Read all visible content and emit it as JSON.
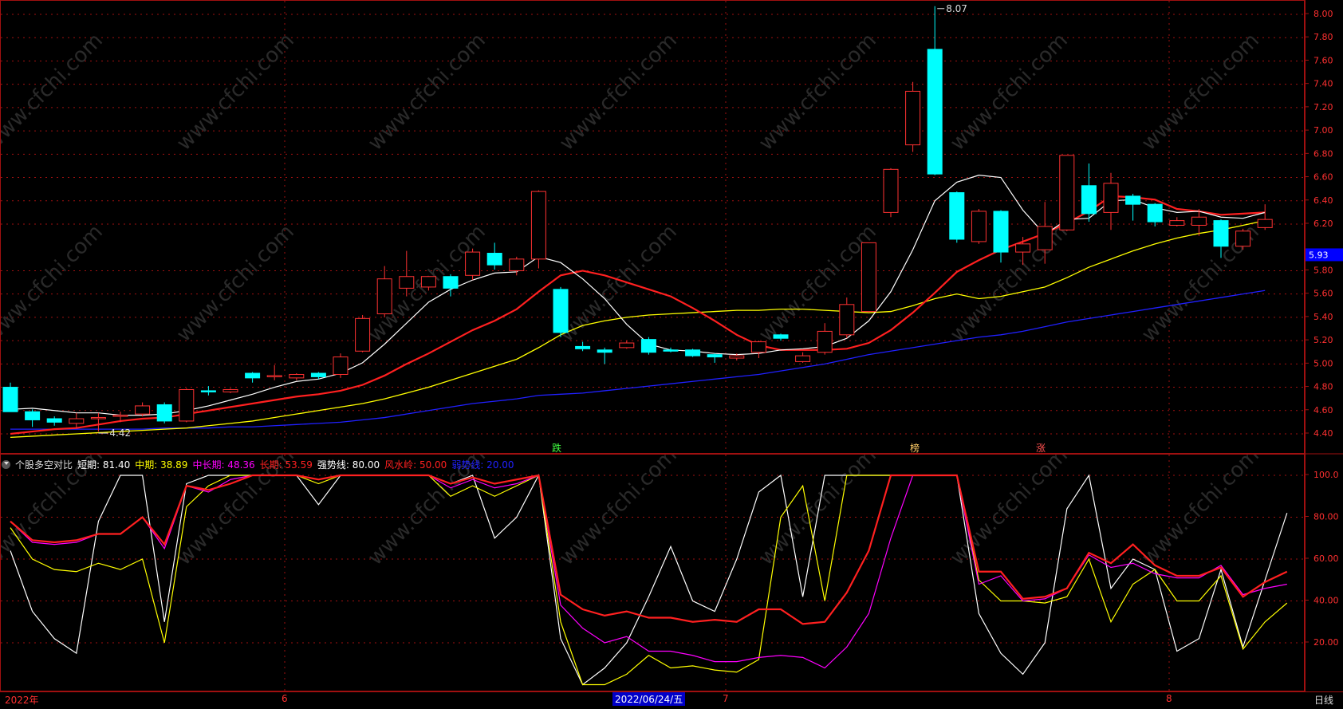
{
  "price_axis": {
    "labels": [
      "8.00",
      "7.80",
      "7.60",
      "7.40",
      "7.20",
      "7.00",
      "6.80",
      "6.60",
      "6.40",
      "6.20",
      "5.80",
      "5.60",
      "5.40",
      "5.20",
      "5.00",
      "4.80",
      "4.60",
      "4.40"
    ],
    "current_price": "5.93",
    "current_price_bg": "#0000ff"
  },
  "sub_axis": {
    "labels": [
      "100.0",
      "80.00",
      "60.00",
      "40.00",
      "20.00"
    ]
  },
  "annotations": {
    "high": "8.07",
    "low": "4.42",
    "marker_die": "跌",
    "marker_bang": "榜",
    "marker_zhang": "涨"
  },
  "indicator": {
    "name": "个股多空对比",
    "items": [
      {
        "text": "短期: 81.40",
        "color": "#ffffff"
      },
      {
        "text": "中期: 38.89",
        "color": "#ffff00"
      },
      {
        "text": "中长期: 48.36",
        "color": "#ff00ff"
      },
      {
        "text": "长期: 53.59",
        "color": "#ff2020"
      },
      {
        "text": "强势线: 80.00",
        "color": "#ffffff"
      },
      {
        "text": "风水岭: 50.00",
        "color": "#ff2020"
      },
      {
        "text": "弱势线: 20.00",
        "color": "#2020ff"
      }
    ]
  },
  "date_bar": {
    "year": "2022年",
    "m6": "6",
    "selected_date": "2022/06/24/五",
    "m7": "7",
    "m8": "8",
    "period": "日线"
  },
  "watermark": "www.cfchi.com",
  "colors": {
    "up": "#ff3232",
    "down": "#00ffff",
    "ma5": "#ffffff",
    "ma10": "#ff2020",
    "ma20": "#ffff00",
    "ma60": "#2020ff",
    "grid": "#a01010"
  },
  "candles": [
    {
      "o": 4.8,
      "h": 4.84,
      "l": 4.62,
      "c": 4.59
    },
    {
      "o": 4.59,
      "h": 4.61,
      "l": 4.46,
      "c": 4.52
    },
    {
      "o": 4.53,
      "h": 4.55,
      "l": 4.47,
      "c": 4.5
    },
    {
      "o": 4.49,
      "h": 4.58,
      "l": 4.45,
      "c": 4.53
    },
    {
      "o": 4.53,
      "h": 4.58,
      "l": 4.42,
      "c": 4.54
    },
    {
      "o": 4.55,
      "h": 4.59,
      "l": 4.5,
      "c": 4.56
    },
    {
      "o": 4.57,
      "h": 4.67,
      "l": 4.55,
      "c": 4.64
    },
    {
      "o": 4.65,
      "h": 4.67,
      "l": 4.49,
      "c": 4.51
    },
    {
      "o": 4.51,
      "h": 4.79,
      "l": 4.5,
      "c": 4.78
    },
    {
      "o": 4.77,
      "h": 4.81,
      "l": 4.73,
      "c": 4.76
    },
    {
      "o": 4.76,
      "h": 4.79,
      "l": 4.75,
      "c": 4.78
    },
    {
      "o": 4.92,
      "h": 4.93,
      "l": 4.84,
      "c": 4.88
    },
    {
      "o": 4.9,
      "h": 4.99,
      "l": 4.86,
      "c": 4.9
    },
    {
      "o": 4.88,
      "h": 4.92,
      "l": 4.86,
      "c": 4.91
    },
    {
      "o": 4.92,
      "h": 4.93,
      "l": 4.87,
      "c": 4.89
    },
    {
      "o": 4.91,
      "h": 5.09,
      "l": 4.88,
      "c": 5.06
    },
    {
      "o": 5.11,
      "h": 5.42,
      "l": 5.1,
      "c": 5.39
    },
    {
      "o": 5.43,
      "h": 5.84,
      "l": 5.4,
      "c": 5.73
    },
    {
      "o": 5.65,
      "h": 5.97,
      "l": 5.58,
      "c": 5.75
    },
    {
      "o": 5.66,
      "h": 5.75,
      "l": 5.63,
      "c": 5.75
    },
    {
      "o": 5.75,
      "h": 5.77,
      "l": 5.58,
      "c": 5.65
    },
    {
      "o": 5.76,
      "h": 5.99,
      "l": 5.72,
      "c": 5.96
    },
    {
      "o": 5.95,
      "h": 6.04,
      "l": 5.81,
      "c": 5.85
    },
    {
      "o": 5.8,
      "h": 5.92,
      "l": 5.76,
      "c": 5.9
    },
    {
      "o": 5.9,
      "h": 6.49,
      "l": 5.82,
      "c": 6.48
    },
    {
      "o": 5.64,
      "h": 5.66,
      "l": 5.23,
      "c": 5.27
    },
    {
      "o": 5.15,
      "h": 5.19,
      "l": 5.11,
      "c": 5.13
    },
    {
      "o": 5.12,
      "h": 5.14,
      "l": 5.0,
      "c": 5.1
    },
    {
      "o": 5.14,
      "h": 5.2,
      "l": 5.13,
      "c": 5.18
    },
    {
      "o": 5.21,
      "h": 5.23,
      "l": 5.08,
      "c": 5.1
    },
    {
      "o": 5.12,
      "h": 5.14,
      "l": 5.1,
      "c": 5.11
    },
    {
      "o": 5.12,
      "h": 5.13,
      "l": 5.06,
      "c": 5.07
    },
    {
      "o": 5.08,
      "h": 5.09,
      "l": 5.01,
      "c": 5.06
    },
    {
      "o": 5.05,
      "h": 5.09,
      "l": 5.03,
      "c": 5.07
    },
    {
      "o": 5.1,
      "h": 5.2,
      "l": 5.05,
      "c": 5.19
    },
    {
      "o": 5.25,
      "h": 5.26,
      "l": 5.2,
      "c": 5.22
    },
    {
      "o": 5.02,
      "h": 5.1,
      "l": 5.01,
      "c": 5.07
    },
    {
      "o": 5.1,
      "h": 5.35,
      "l": 5.08,
      "c": 5.28
    },
    {
      "o": 5.25,
      "h": 5.57,
      "l": 5.22,
      "c": 5.51
    },
    {
      "o": 5.45,
      "h": 6.0,
      "l": 5.44,
      "c": 6.04
    },
    {
      "o": 6.3,
      "h": 6.68,
      "l": 6.26,
      "c": 6.67
    },
    {
      "o": 6.88,
      "h": 7.42,
      "l": 6.82,
      "c": 7.34
    },
    {
      "o": 7.7,
      "h": 8.07,
      "l": 6.62,
      "c": 6.63
    },
    {
      "o": 6.47,
      "h": 6.48,
      "l": 6.04,
      "c": 6.07
    },
    {
      "o": 6.05,
      "h": 6.33,
      "l": 6.03,
      "c": 6.31
    },
    {
      "o": 6.31,
      "h": 6.32,
      "l": 5.87,
      "c": 5.96
    },
    {
      "o": 5.96,
      "h": 6.09,
      "l": 5.85,
      "c": 6.03
    },
    {
      "o": 5.98,
      "h": 6.39,
      "l": 5.86,
      "c": 6.18
    },
    {
      "o": 6.15,
      "h": 6.79,
      "l": 6.14,
      "c": 6.79
    },
    {
      "o": 6.53,
      "h": 6.72,
      "l": 6.22,
      "c": 6.29
    },
    {
      "o": 6.3,
      "h": 6.64,
      "l": 6.15,
      "c": 6.55
    },
    {
      "o": 6.44,
      "h": 6.46,
      "l": 6.23,
      "c": 6.37
    },
    {
      "o": 6.37,
      "h": 6.38,
      "l": 6.18,
      "c": 6.22
    },
    {
      "o": 6.19,
      "h": 6.26,
      "l": 6.18,
      "c": 6.23
    },
    {
      "o": 6.19,
      "h": 6.33,
      "l": 6.1,
      "c": 6.26
    },
    {
      "o": 6.23,
      "h": 6.24,
      "l": 5.91,
      "c": 6.01
    },
    {
      "o": 6.01,
      "h": 6.16,
      "l": 5.98,
      "c": 6.14
    },
    {
      "o": 6.17,
      "h": 6.37,
      "l": 6.15,
      "c": 6.24
    }
  ],
  "ma5": [
    4.61,
    4.62,
    4.6,
    4.58,
    4.58,
    4.56,
    4.56,
    4.57,
    4.6,
    4.64,
    4.69,
    4.74,
    4.8,
    4.85,
    4.87,
    4.92,
    5.01,
    5.17,
    5.35,
    5.53,
    5.64,
    5.72,
    5.78,
    5.79,
    5.92,
    5.87,
    5.73,
    5.56,
    5.34,
    5.17,
    5.12,
    5.11,
    5.09,
    5.08,
    5.09,
    5.12,
    5.13,
    5.15,
    5.22,
    5.37,
    5.62,
    5.98,
    6.4,
    6.56,
    6.62,
    6.6,
    6.32,
    6.11,
    6.24,
    6.25,
    6.4,
    6.41,
    6.34,
    6.3,
    6.31,
    6.26,
    6.25,
    6.3
  ],
  "ma10": [
    4.4,
    4.42,
    4.44,
    4.45,
    4.48,
    4.51,
    4.53,
    4.54,
    4.57,
    4.6,
    4.63,
    4.66,
    4.69,
    4.72,
    4.74,
    4.77,
    4.82,
    4.9,
    5.0,
    5.09,
    5.19,
    5.29,
    5.37,
    5.47,
    5.62,
    5.76,
    5.8,
    5.76,
    5.7,
    5.64,
    5.58,
    5.48,
    5.37,
    5.25,
    5.16,
    5.12,
    5.12,
    5.12,
    5.13,
    5.18,
    5.29,
    5.44,
    5.61,
    5.79,
    5.89,
    5.98,
    6.05,
    6.12,
    6.21,
    6.31,
    6.44,
    6.43,
    6.41,
    6.33,
    6.31,
    6.28,
    6.29,
    6.3
  ],
  "ma20": [
    4.37,
    4.38,
    4.39,
    4.4,
    4.41,
    4.42,
    4.43,
    4.44,
    4.45,
    4.47,
    4.49,
    4.51,
    4.54,
    4.57,
    4.6,
    4.63,
    4.66,
    4.7,
    4.75,
    4.8,
    4.86,
    4.92,
    4.98,
    5.04,
    5.14,
    5.25,
    5.33,
    5.37,
    5.4,
    5.42,
    5.43,
    5.44,
    5.45,
    5.46,
    5.46,
    5.47,
    5.47,
    5.46,
    5.45,
    5.44,
    5.45,
    5.5,
    5.56,
    5.6,
    5.56,
    5.58,
    5.62,
    5.66,
    5.74,
    5.83,
    5.9,
    5.97,
    6.03,
    6.08,
    6.12,
    6.15,
    6.19,
    6.23
  ],
  "ma60": [
    4.44,
    4.44,
    4.44,
    4.44,
    4.44,
    4.44,
    4.44,
    4.45,
    4.45,
    4.45,
    4.46,
    4.46,
    4.47,
    4.48,
    4.49,
    4.5,
    4.52,
    4.54,
    4.57,
    4.6,
    4.63,
    4.66,
    4.68,
    4.7,
    4.73,
    4.74,
    4.75,
    4.77,
    4.79,
    4.81,
    4.83,
    4.85,
    4.87,
    4.89,
    4.91,
    4.94,
    4.97,
    5.0,
    5.04,
    5.08,
    5.11,
    5.14,
    5.17,
    5.2,
    5.23,
    5.25,
    5.28,
    5.32,
    5.36,
    5.39,
    5.42,
    5.45,
    5.48,
    5.51,
    5.54,
    5.57,
    5.6,
    5.63
  ],
  "osc_short": [
    64,
    35,
    22,
    15,
    78,
    100,
    100,
    30,
    96,
    100,
    100,
    100,
    100,
    100,
    86,
    100,
    100,
    100,
    100,
    100,
    96,
    100,
    70,
    80,
    100,
    22,
    0,
    8,
    20,
    42,
    66,
    40,
    35,
    60,
    92,
    100,
    42,
    100,
    100,
    100,
    100,
    100,
    100,
    100,
    34,
    15,
    5,
    20,
    84,
    100,
    46,
    60,
    55,
    16,
    22,
    55,
    18,
    50,
    82
  ],
  "osc_mid": [
    75,
    60,
    55,
    54,
    58,
    55,
    60,
    20,
    85,
    95,
    100,
    100,
    100,
    100,
    96,
    100,
    100,
    100,
    100,
    100,
    90,
    95,
    90,
    95,
    100,
    30,
    0,
    0,
    5,
    14,
    8,
    9,
    7,
    6,
    12,
    80,
    95,
    40,
    100,
    100,
    100,
    100,
    100,
    100,
    50,
    40,
    40,
    39,
    42,
    60,
    30,
    48,
    55,
    40,
    40,
    52,
    17,
    30,
    39
  ],
  "osc_midlong": [
    78,
    68,
    67,
    68,
    72,
    72,
    80,
    65,
    95,
    92,
    98,
    100,
    100,
    100,
    98,
    100,
    100,
    100,
    100,
    100,
    94,
    98,
    94,
    96,
    100,
    38,
    27,
    20,
    23,
    16,
    16,
    14,
    11,
    11,
    13,
    14,
    13,
    8,
    18,
    34,
    70,
    100,
    100,
    100,
    48,
    52,
    40,
    41,
    46,
    62,
    56,
    58,
    53,
    51,
    51,
    57,
    43,
    46,
    48
  ],
  "osc_long": [
    78,
    69,
    68,
    69,
    72,
    72,
    80,
    67,
    95,
    93,
    96,
    100,
    100,
    100,
    98,
    100,
    100,
    100,
    100,
    100,
    96,
    99,
    96,
    98,
    100,
    43,
    36,
    33,
    35,
    32,
    32,
    30,
    31,
    30,
    36,
    36,
    29,
    30,
    44,
    64,
    100,
    100,
    100,
    100,
    54,
    54,
    41,
    42,
    46,
    63,
    58,
    67,
    57,
    52,
    52,
    56,
    42,
    49,
    54
  ]
}
